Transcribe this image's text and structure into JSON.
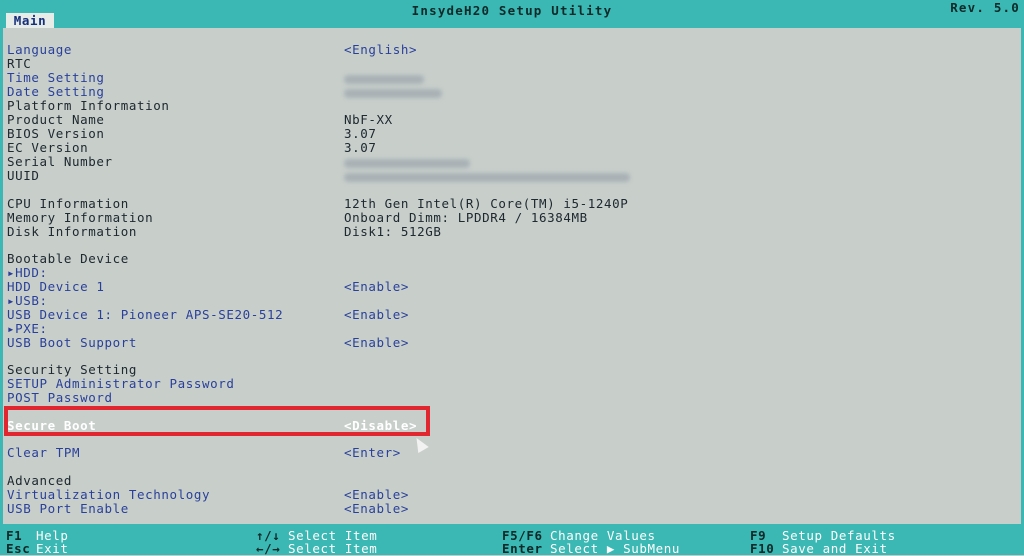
{
  "header": {
    "title": "InsydeH20 Setup Utility",
    "revision": "Rev. 5.0",
    "tab": "Main"
  },
  "rows": [
    {
      "label": "Language",
      "value": "<English>",
      "blur": false
    },
    {
      "label": "RTC",
      "value": "",
      "blur": false
    },
    {
      "label": "Time Setting",
      "value": "",
      "blur": true
    },
    {
      "label": "Date Setting",
      "value": "",
      "blur": true
    },
    {
      "label": "Platform Information",
      "value": "",
      "blur": false
    },
    {
      "label": "Product Name",
      "value": "NbF-XX",
      "blur": false
    },
    {
      "label": "BIOS Version",
      "value": "3.07",
      "blur": false
    },
    {
      "label": "EC Version",
      "value": "3.07",
      "blur": false
    },
    {
      "label": "Serial Number",
      "value": "",
      "blur": true
    },
    {
      "label": "UUID",
      "value": "",
      "blur": true
    },
    {
      "label": "CPU Information",
      "value": "12th Gen Intel(R) Core(TM) i5-1240P",
      "blur": false
    },
    {
      "label": "Memory Information",
      "value": "Onboard Dimm: LPDDR4 / 16384MB",
      "blur": false
    },
    {
      "label": "Disk Information",
      "value": "Disk1:  512GB",
      "blur": false
    },
    {
      "label": "Bootable Device",
      "value": "",
      "blur": false
    },
    {
      "label": "▸HDD:",
      "value": "",
      "blur": false
    },
    {
      "label": "HDD Device 1",
      "value": "<Enable>",
      "blur": false
    },
    {
      "label": "▸USB:",
      "value": "",
      "blur": false
    },
    {
      "label": "USB Device 1: Pioneer APS-SE20-512",
      "value": "<Enable>",
      "blur": false
    },
    {
      "label": "▸PXE:",
      "value": "",
      "blur": false
    },
    {
      "label": "USB Boot Support",
      "value": "<Enable>",
      "blur": false
    },
    {
      "label": "Security Setting",
      "value": "",
      "blur": false
    },
    {
      "label": "SETUP Administrator Password",
      "value": "",
      "blur": false
    },
    {
      "label": "POST Password",
      "value": "",
      "blur": false
    },
    {
      "label": "Secure Boot",
      "value": "<Disable>",
      "blur": false
    },
    {
      "label": "Clear TPM",
      "value": "<Enter>",
      "blur": false
    },
    {
      "label": "Advanced",
      "value": "",
      "blur": false
    },
    {
      "label": "Virtualization Technology",
      "value": "<Enable>",
      "blur": false
    },
    {
      "label": "USB Port Enable",
      "value": "<Enable>",
      "blur": false
    }
  ],
  "footer": {
    "f1_key": "F1",
    "f1_desc": "Help",
    "esc_key": "Esc",
    "esc_desc": "Exit",
    "updown_key": "↑/↓",
    "updown_desc": "Select Item",
    "leftright_key": "←/→",
    "leftright_desc": "Select Item",
    "f5f6_key": "F5/F6",
    "f5f6_desc": "Change Values",
    "enter_key": "Enter",
    "enter_desc": "Select ▶ SubMenu",
    "f9_key": "F9",
    "f9_desc": "Setup Defaults",
    "f10_key": "F10",
    "f10_desc": "Save and Exit"
  },
  "colors": {
    "frame": "#3bb8b3",
    "panel": "#c8cfcb",
    "item_blue": "#2a3f9a",
    "highlight_red": "#e22630"
  }
}
